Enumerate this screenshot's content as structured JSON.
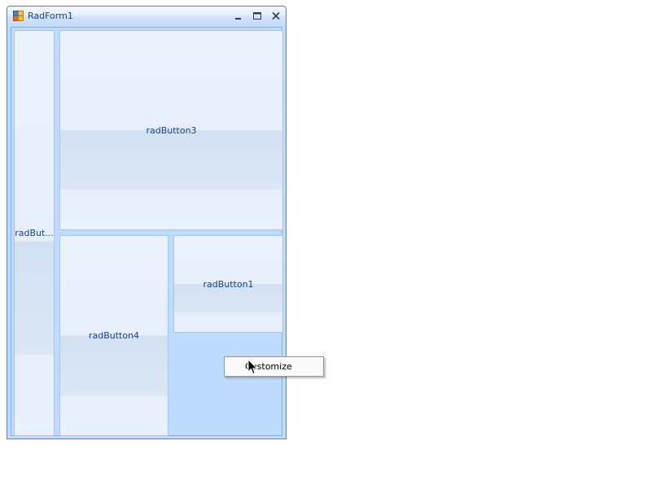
{
  "window": {
    "title": "RadForm1"
  },
  "buttons": {
    "rad_button_2_label": "radBut...",
    "rad_button_3_label": "radButton3",
    "rad_button_4_label": "radButton4",
    "rad_button_1_label": "radButton1"
  },
  "context_menu": {
    "items": [
      {
        "label": "Customize"
      }
    ]
  },
  "colors": {
    "form_background": "#bfdbff",
    "title_text": "#15428b",
    "button_text": "#15428b",
    "frame_border": "#5d80ad"
  },
  "icons": {
    "app": "app-icon",
    "minimize": "minimize-icon",
    "maximize": "maximize-icon",
    "close": "close-icon",
    "cursor": "arrow-cursor-icon"
  }
}
